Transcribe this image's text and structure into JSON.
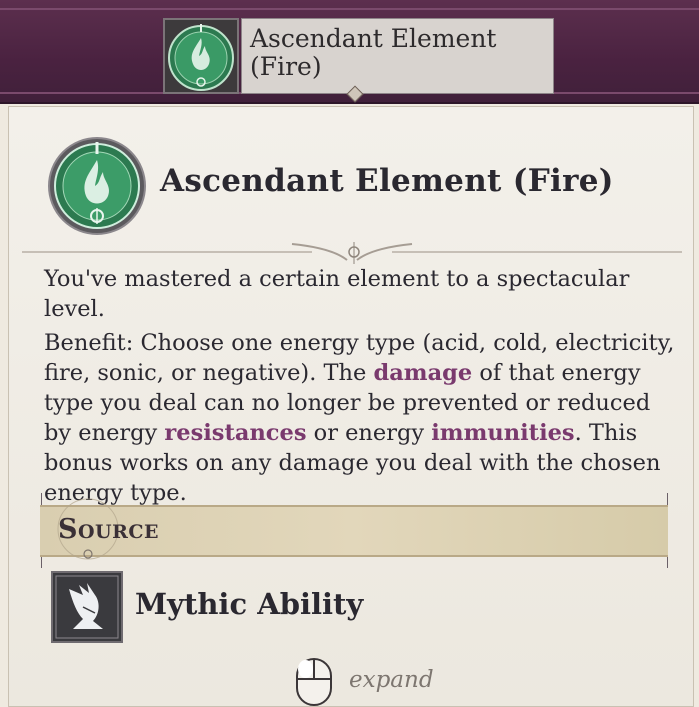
{
  "banner": {
    "title": "Ascendant Element (Fire)",
    "icon": "fire-element-icon"
  },
  "header": {
    "title": "Ascendant Element (Fire)",
    "icon": "fire-element-icon"
  },
  "description": {
    "intro": "You've mastered a certain element to a spectacular level.",
    "benefit_1": "Benefit: Choose one energy type (acid, cold, electricity, fire, sonic, or negative). The ",
    "kw_damage": "damage",
    "benefit_2": " of that energy type you deal can no longer be prevented or reduced by energy ",
    "kw_resistances": "resistances",
    "benefit_3": " or energy ",
    "kw_immunities": "immunities",
    "benefit_4": ". This bonus works on any damage you deal with the chosen energy type."
  },
  "source": {
    "label": "Source",
    "item_label": "Mythic Ability",
    "item_icon": "winged-mythic-icon"
  },
  "footer": {
    "expand_label": "expand",
    "icon": "mouse-icon"
  },
  "colors": {
    "banner": "#4a2240",
    "keyword": "#7a3a6e",
    "icon_green": "#2f8a5a"
  }
}
